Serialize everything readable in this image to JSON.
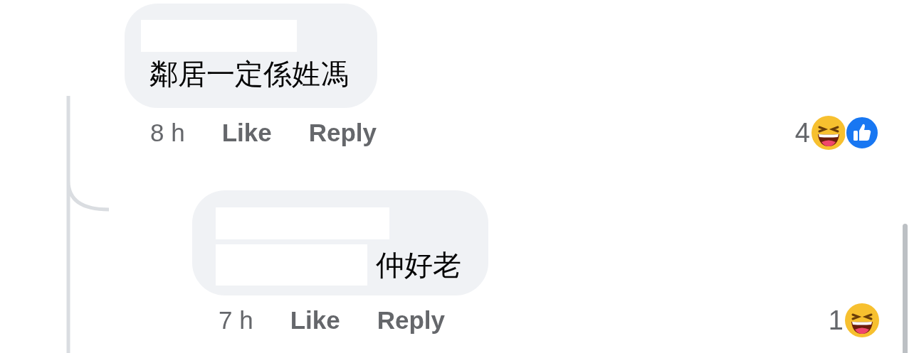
{
  "comments": [
    {
      "text": "鄰居一定係姓馮",
      "time": "8 h",
      "like": "Like",
      "reply": "Reply",
      "reaction_count": "4",
      "reactions": [
        {
          "kind": "haha"
        },
        {
          "kind": "like"
        }
      ],
      "reply_level": false
    },
    {
      "text": "仲好老",
      "time": "7 h",
      "like": "Like",
      "reply": "Reply",
      "reaction_count": "1",
      "reactions": [
        {
          "kind": "haha"
        }
      ],
      "reply_level": true
    }
  ]
}
